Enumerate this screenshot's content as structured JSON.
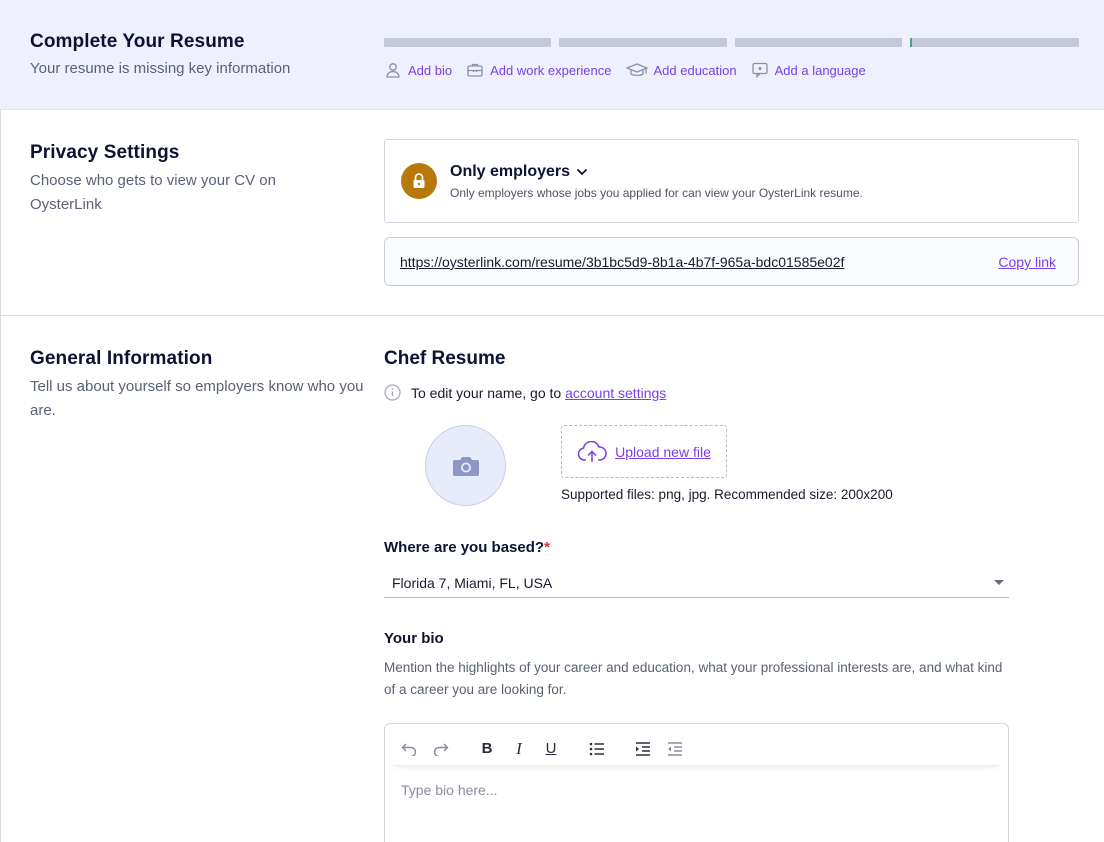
{
  "completion": {
    "title": "Complete Your Resume",
    "subtitle": "Your resume is missing key information",
    "progress_segments": 4,
    "steps": [
      {
        "label": "Add bio",
        "icon": "person-icon"
      },
      {
        "label": "Add work experience",
        "icon": "briefcase-icon"
      },
      {
        "label": "Add education",
        "icon": "graduation-cap-icon"
      },
      {
        "label": "Add a language",
        "icon": "speech-bubble-icon"
      }
    ]
  },
  "privacy": {
    "title": "Privacy Settings",
    "subtitle": "Choose who gets to view your CV on OysterLink",
    "option_label": "Only employers",
    "option_desc": "Only employers whose jobs you applied for can view your OysterLink resume.",
    "resume_url": "https://oysterlink.com/resume/3b1bc5d9-8b1a-4b7f-965a-bdc01585e02f",
    "copy_label": "Copy link"
  },
  "general": {
    "title": "General Information",
    "subtitle": "Tell us about yourself so employers know who you are.",
    "resume_title": "Chef Resume",
    "edit_note": "To edit your name, go to",
    "edit_link": "account settings",
    "upload_label": "Upload new file",
    "supported_files": "Supported files: png, jpg. Recommended size: 200x200",
    "location_label": "Where are you based?",
    "location_required_mark": "*",
    "location_value": "Florida 7, Miami, FL, USA",
    "bio_label": "Your bio",
    "bio_help": "Mention the highlights of your career and education, what your professional interests are, and what kind of a career you are looking for.",
    "bio_placeholder": "Type bio here..."
  },
  "colors": {
    "accent": "#7b3fe4",
    "banner_bg": "#eef1fd",
    "lock_bg": "#b8790a"
  }
}
